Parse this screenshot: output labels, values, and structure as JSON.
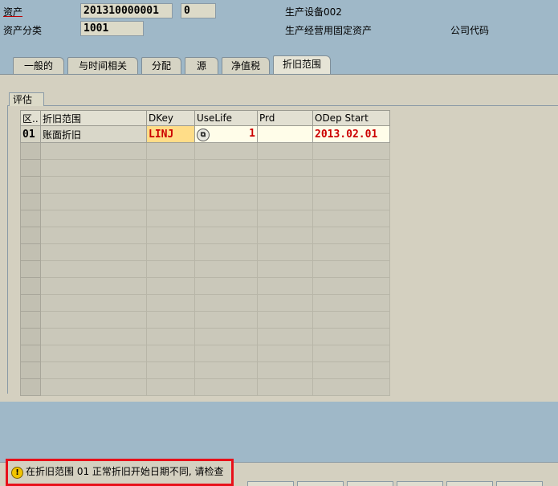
{
  "header": {
    "asset_label": "资产",
    "asset_number": "201310000001",
    "asset_sub": "0",
    "asset_class_label": "资产分类",
    "asset_class": "1001",
    "asset_desc": "生产设备002",
    "class_desc": "生产经营用固定资产",
    "company_code_label": "公司代码"
  },
  "tabs": [
    "一般的",
    "与时间相关",
    "分配",
    "源",
    "净值税",
    "折旧范围"
  ],
  "active_tab": "折旧范围",
  "group_title": "评估",
  "table": {
    "columns": [
      "区..",
      "折旧范围",
      "DKey",
      "UseLife",
      "Prd",
      "ODep Start"
    ],
    "rows": [
      {
        "area": "01",
        "name": "账面折旧",
        "dkey": "LINJ",
        "uselife": "1",
        "prd": "",
        "odep_start": "2013.02.01"
      }
    ],
    "empty_rows": 15
  },
  "status": {
    "icon": "warning-icon",
    "message": "在折旧范围 01 正常折旧开始日期不同, 请检查"
  },
  "colors": {
    "background": "#9fb8c8",
    "panel": "#d4d0c0",
    "highlight_border": "#e8101a",
    "error_text": "#cc0000",
    "key_field": "#ffdd88"
  }
}
